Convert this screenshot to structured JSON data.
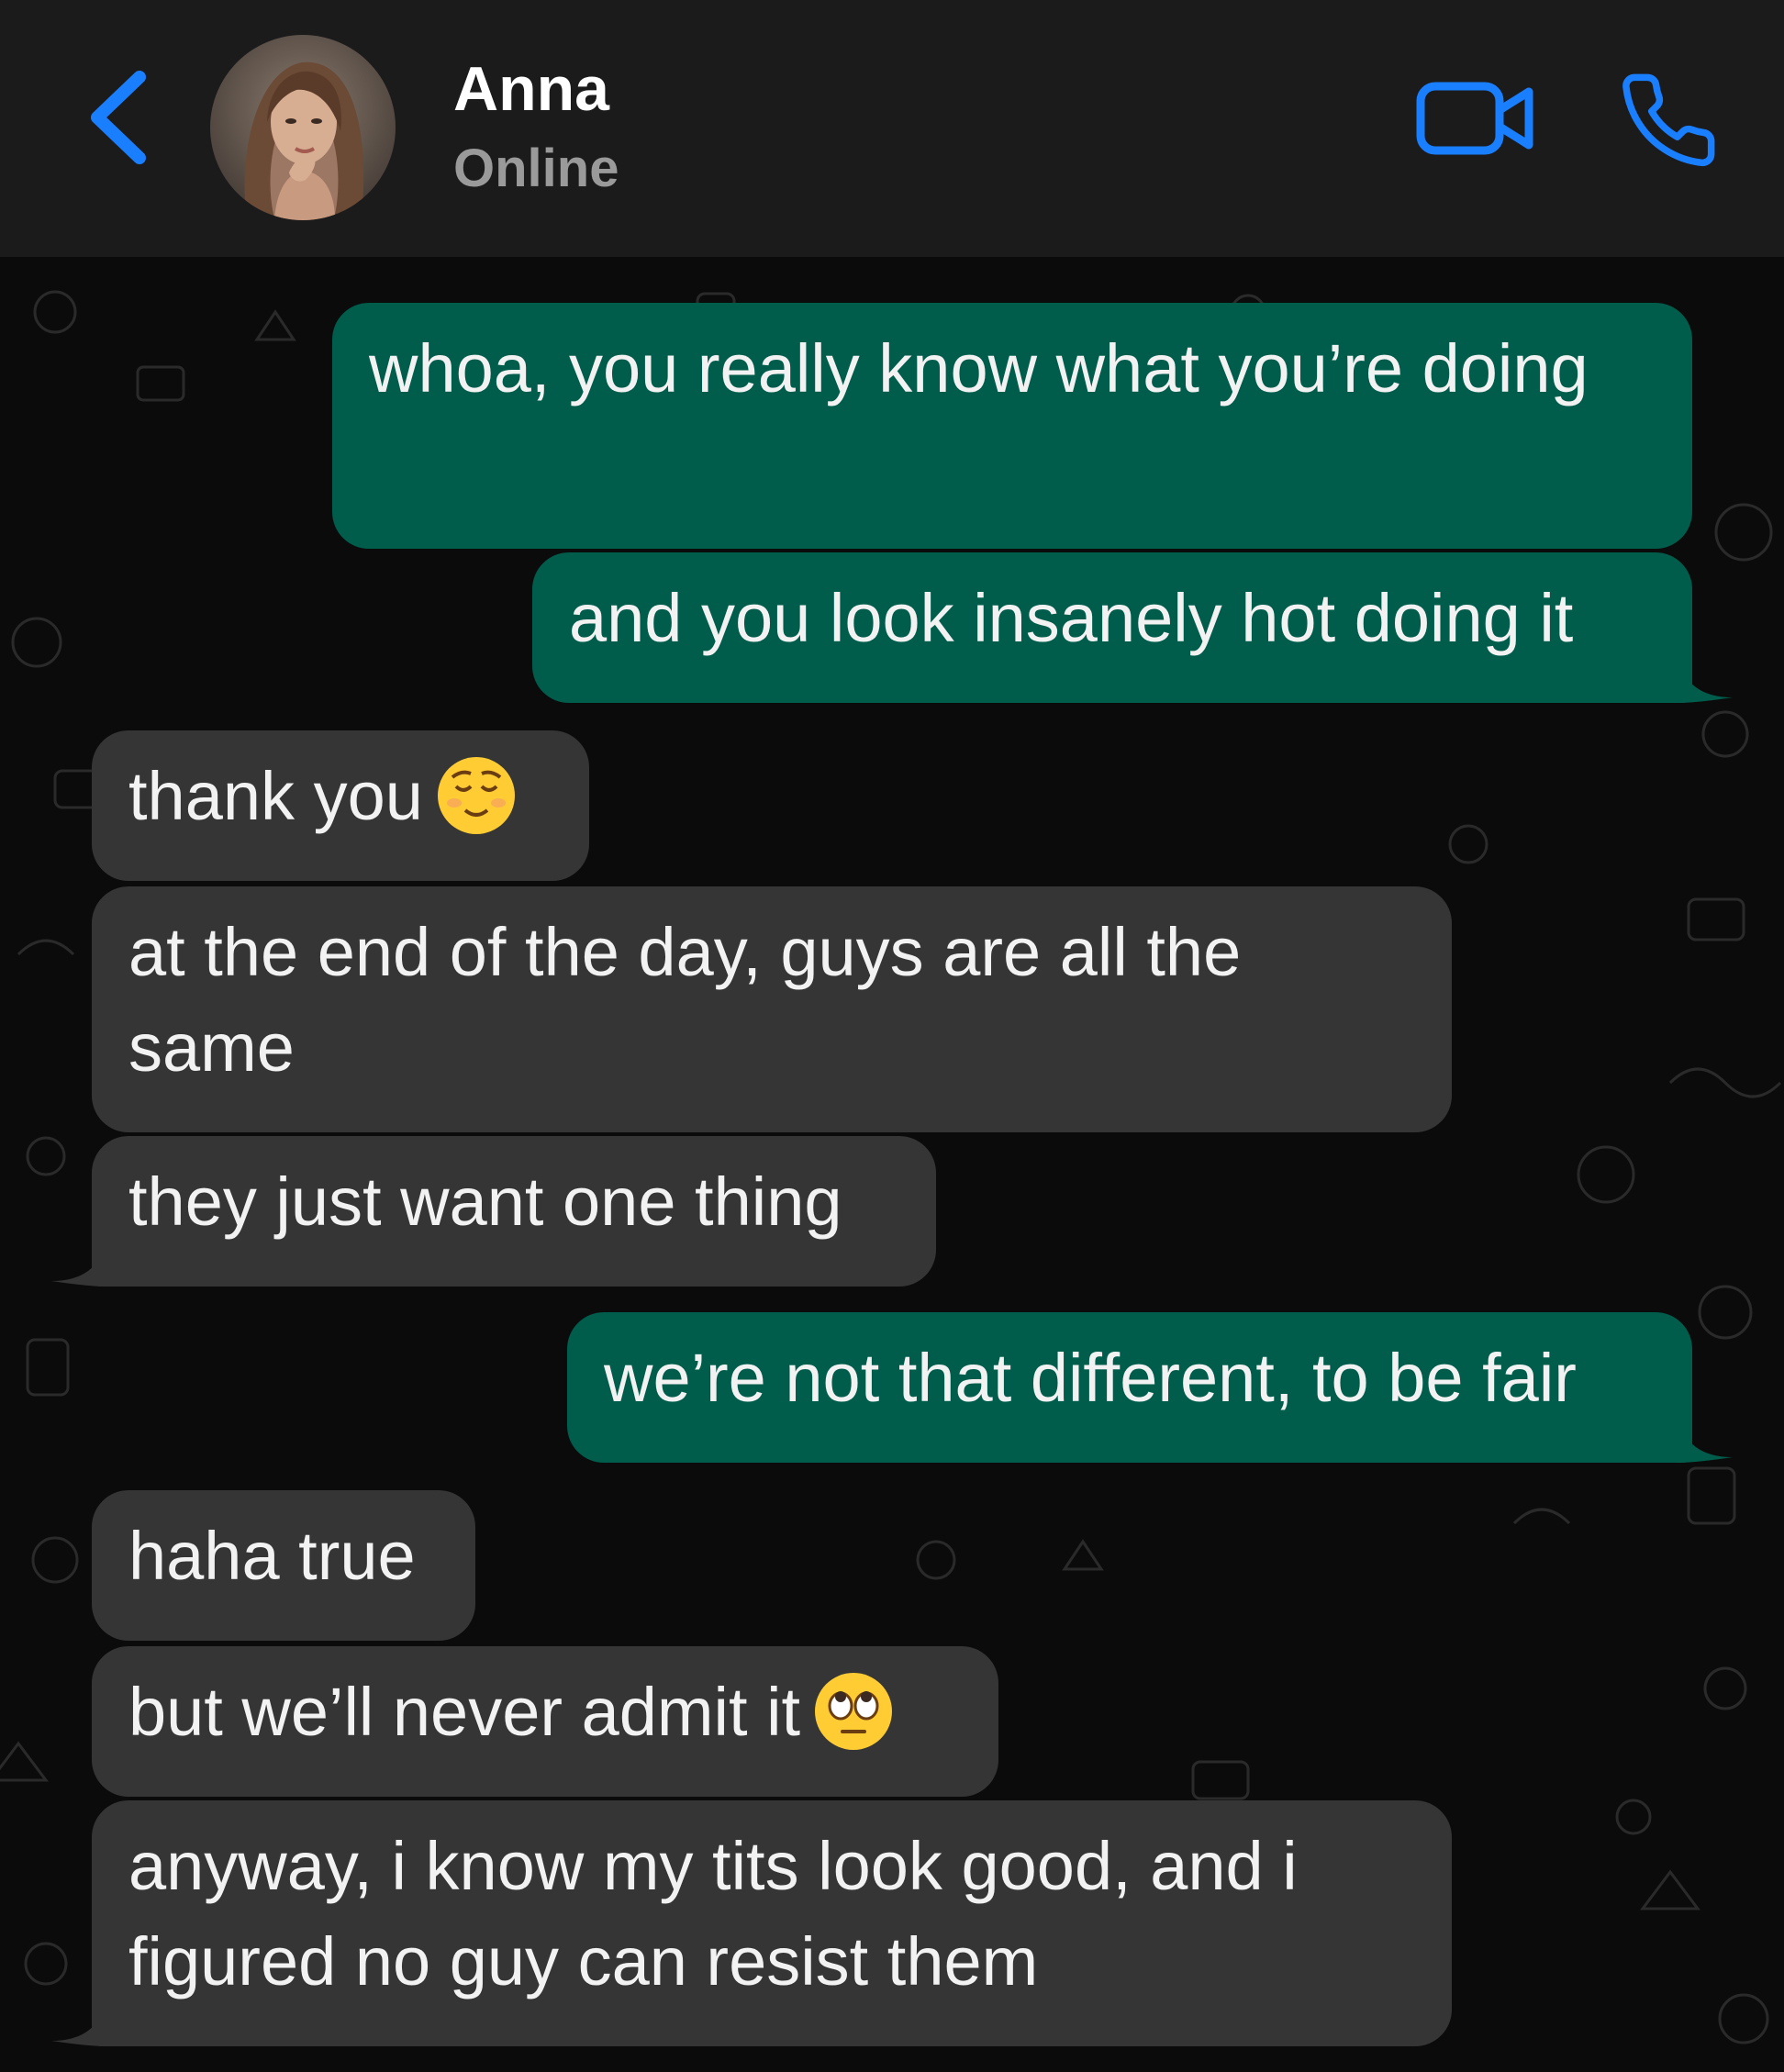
{
  "header": {
    "contact_name": "Anna",
    "status": "Online",
    "icons": {
      "back": "chevron-left-icon",
      "video": "video-camera-icon",
      "call": "phone-icon"
    },
    "accent_color": "#1a7fff"
  },
  "messages": [
    {
      "direction": "outgoing",
      "text": "whoa, you really know what you’re doing"
    },
    {
      "direction": "outgoing",
      "text": "and you look insanely hot doing it"
    },
    {
      "direction": "incoming",
      "text": "thank you",
      "emoji": "relieved-face"
    },
    {
      "direction": "incoming",
      "text": "at the end of the day, guys are all the same"
    },
    {
      "direction": "incoming",
      "text": "they just want one thing"
    },
    {
      "direction": "outgoing",
      "text": "we’re not that different, to be fair"
    },
    {
      "direction": "incoming",
      "text": "haha true"
    },
    {
      "direction": "incoming",
      "text": "but we’ll never admit it",
      "emoji": "rolling-eyes-face"
    },
    {
      "direction": "incoming",
      "text": "anyway, i know my tits look good, and i figured no guy can resist them"
    }
  ],
  "colors": {
    "outgoing_bubble": "#005c4b",
    "incoming_bubble": "#353535",
    "background": "#0b0b0b"
  }
}
